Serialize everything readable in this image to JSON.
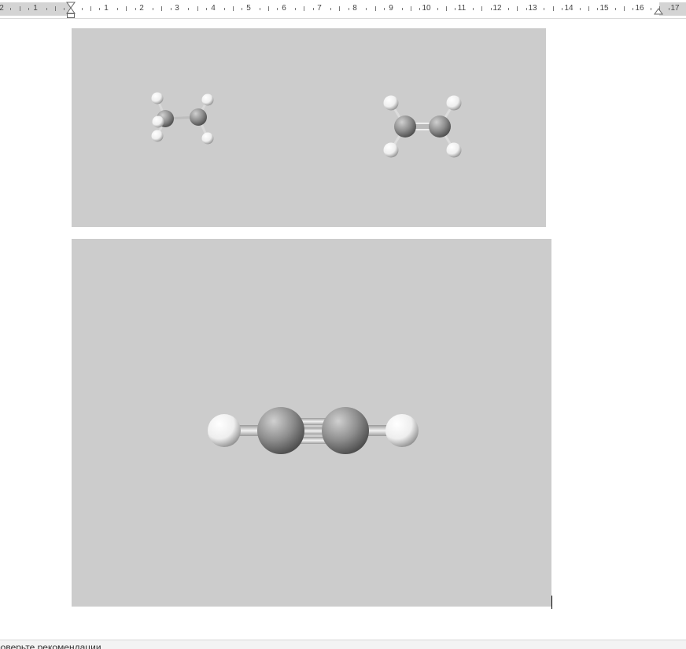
{
  "ruler": {
    "numbers": [
      "2",
      "1",
      "1",
      "2",
      "3",
      "4",
      "5",
      "6",
      "7",
      "8",
      "9",
      "10",
      "11",
      "12",
      "13",
      "14",
      "15",
      "16",
      "17"
    ]
  },
  "status": {
    "text": "роверьте рекомендации"
  },
  "colors": {
    "image_background": "#cccccc",
    "carbon_atom": "#8a8a8a",
    "hydrogen_atom": "#f4f4f4",
    "bond": "#d8d8d8"
  }
}
